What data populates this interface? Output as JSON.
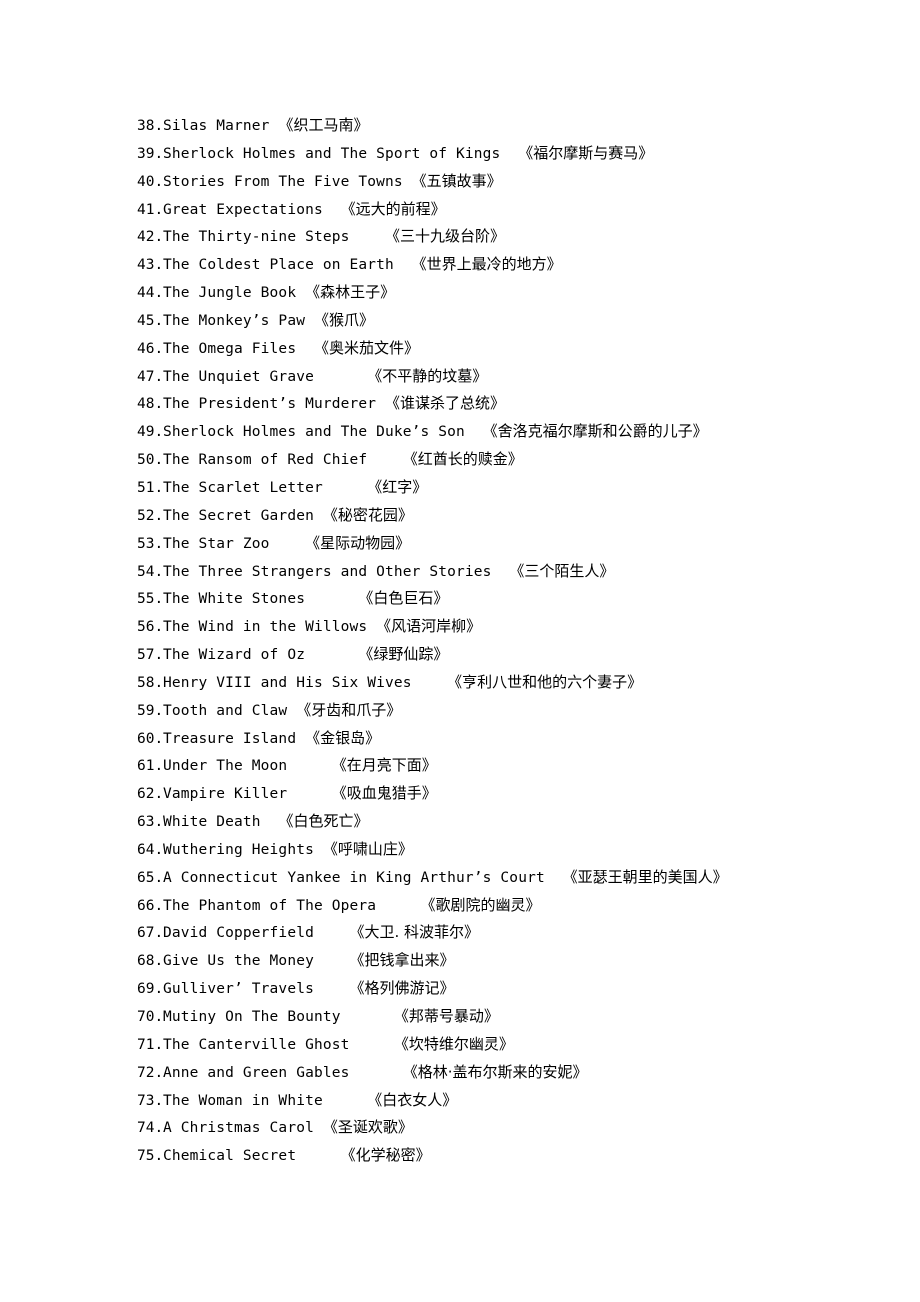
{
  "document": {
    "type": "book-list",
    "list_range": "38-75",
    "items": [
      {
        "number": "38.",
        "title": "Silas Marner ",
        "chinese": "《织工马南》"
      },
      {
        "number": "39.",
        "title": "Sherlock Holmes and The Sport of Kings  ",
        "chinese": "《福尔摩斯与赛马》"
      },
      {
        "number": "40.",
        "title": "Stories From The Five Towns ",
        "chinese": "《五镇故事》"
      },
      {
        "number": "41.",
        "title": "Great Expectations  ",
        "chinese": "《远大的前程》"
      },
      {
        "number": "42.",
        "title": "The Thirty-nine Steps    ",
        "chinese": "《三十九级台阶》"
      },
      {
        "number": "43.",
        "title": "The Coldest Place on Earth  ",
        "chinese": "《世界上最冷的地方》"
      },
      {
        "number": "44.",
        "title": "The Jungle Book ",
        "chinese": "《森林王子》"
      },
      {
        "number": "45.",
        "title": "The Monkey’s Paw ",
        "chinese": "《猴爪》"
      },
      {
        "number": "46.",
        "title": "The Omega Files  ",
        "chinese": "《奥米茄文件》"
      },
      {
        "number": "47.",
        "title": "The Unquiet Grave      ",
        "chinese": "《不平静的坟墓》"
      },
      {
        "number": "48.",
        "title": "The President’s Murderer ",
        "chinese": "《谁谋杀了总统》"
      },
      {
        "number": "49.",
        "title": "Sherlock Holmes and The Duke’s Son  ",
        "chinese": "《舍洛克福尔摩斯和公爵的儿子》"
      },
      {
        "number": "50.",
        "title": "The Ransom of Red Chief    ",
        "chinese": "《红酋长的赎金》"
      },
      {
        "number": "51.",
        "title": "The Scarlet Letter     ",
        "chinese": "《红字》"
      },
      {
        "number": "52.",
        "title": "The Secret Garden ",
        "chinese": "《秘密花园》"
      },
      {
        "number": "53.",
        "title": "The Star Zoo    ",
        "chinese": "《星际动物园》"
      },
      {
        "number": "54.",
        "title": "The Three Strangers and Other Stories  ",
        "chinese": "《三个陌生人》"
      },
      {
        "number": "55.",
        "title": "The White Stones      ",
        "chinese": "《白色巨石》"
      },
      {
        "number": "56.",
        "title": "The Wind in the Willows ",
        "chinese": "《风语河岸柳》"
      },
      {
        "number": "57.",
        "title": "The Wizard of Oz      ",
        "chinese": "《绿野仙踪》"
      },
      {
        "number": "58.",
        "title": "Henry VIII and His Six Wives    ",
        "chinese": "《亨利八世和他的六个妻子》"
      },
      {
        "number": "59.",
        "title": "Tooth and Claw ",
        "chinese": "《牙齿和爪子》"
      },
      {
        "number": "60.",
        "title": "Treasure Island ",
        "chinese": "《金银岛》"
      },
      {
        "number": "61.",
        "title": "Under The Moon     ",
        "chinese": "《在月亮下面》"
      },
      {
        "number": "62.",
        "title": "Vampire Killer     ",
        "chinese": "《吸血鬼猎手》"
      },
      {
        "number": "63.",
        "title": "White Death  ",
        "chinese": "《白色死亡》"
      },
      {
        "number": "64.",
        "title": "Wuthering Heights ",
        "chinese": "《呼啸山庄》"
      },
      {
        "number": "65.",
        "title": "A Connecticut Yankee in King Arthur’s Court  ",
        "chinese": "《亚瑟王朝里的美国人》"
      },
      {
        "number": "66.",
        "title": "The Phantom of The Opera     ",
        "chinese": "《歌剧院的幽灵》"
      },
      {
        "number": "67.",
        "title": "David Copperfield    ",
        "chinese": "《大卫. 科波菲尔》"
      },
      {
        "number": "68.",
        "title": "Give Us the Money    ",
        "chinese": "《把钱拿出来》"
      },
      {
        "number": "69.",
        "title": "Gulliver’ Travels    ",
        "chinese": "《格列佛游记》"
      },
      {
        "number": "70.",
        "title": "Mutiny On The Bounty      ",
        "chinese": "《邦蒂号暴动》"
      },
      {
        "number": "71.",
        "title": "The Canterville Ghost     ",
        "chinese": "《坎特维尔幽灵》"
      },
      {
        "number": "72.",
        "title": "Anne and Green Gables      ",
        "chinese": "《格林·盖布尔斯来的安妮》"
      },
      {
        "number": "73.",
        "title": "The Woman in White     ",
        "chinese": "《白衣女人》"
      },
      {
        "number": "74.",
        "title": "A Christmas Carol ",
        "chinese": "《圣诞欢歌》"
      },
      {
        "number": "75.",
        "title": "Chemical Secret     ",
        "chinese": "《化学秘密》"
      }
    ]
  }
}
